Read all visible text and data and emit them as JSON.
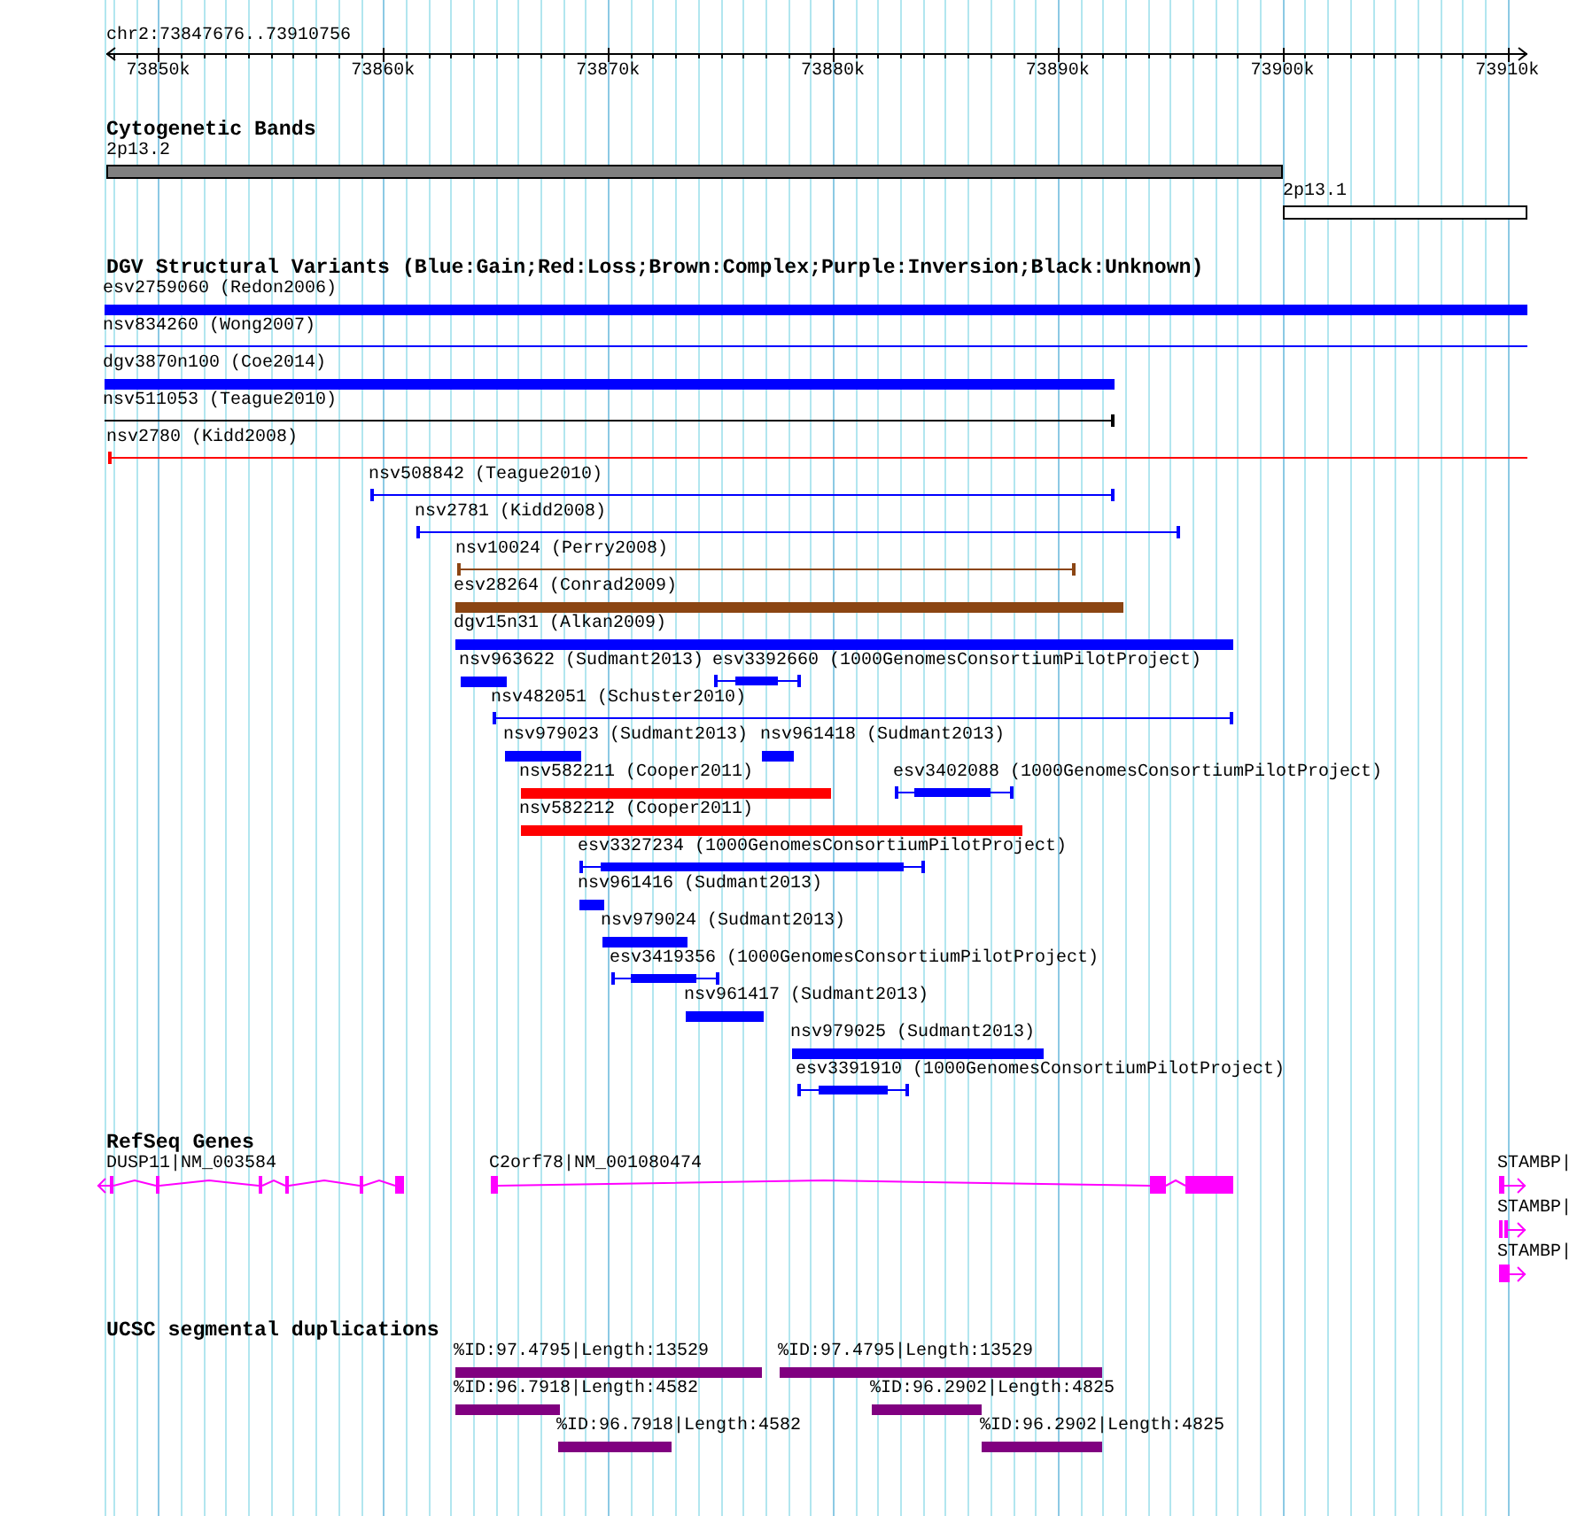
{
  "ruler": {
    "range": "chr2:73847676..73910756",
    "ticks": [
      "73850k",
      "73860k",
      "73870k",
      "73880k",
      "73890k",
      "73900k",
      "73910k"
    ]
  },
  "cytogenetic_bands": {
    "title": "Cytogenetic Bands",
    "bands": [
      {
        "name": "2p13.2",
        "color": "#808080"
      },
      {
        "name": "2p13.1",
        "color": "#ffffff"
      }
    ]
  },
  "dgv": {
    "title": "DGV Structural Variants (Blue:Gain;Red:Loss;Brown:Complex;Purple:Inversion;Black:Unknown)",
    "rows": [
      [
        {
          "label": "esv2759060 (Redon2006)",
          "kind": "bar",
          "color": "#0000ff"
        }
      ],
      [
        {
          "label": "nsv834260 (Wong2007)",
          "kind": "line",
          "color": "#0000ff"
        }
      ],
      [
        {
          "label": "dgv3870n100 (Coe2014)",
          "kind": "bar",
          "color": "#0000ff"
        }
      ],
      [
        {
          "label": "nsv511053 (Teague2010)",
          "kind": "line",
          "color": "#000000"
        }
      ],
      [
        {
          "label": "nsv2780 (Kidd2008)",
          "kind": "line",
          "color": "#ff0000"
        }
      ],
      [
        {
          "label": "nsv508842 (Teague2010)",
          "kind": "line",
          "color": "#0000ff"
        }
      ],
      [
        {
          "label": "nsv2781 (Kidd2008)",
          "kind": "line",
          "color": "#0000ff"
        }
      ],
      [
        {
          "label": "nsv10024 (Perry2008)",
          "kind": "line",
          "color": "#8b4513"
        }
      ],
      [
        {
          "label": "esv28264 (Conrad2009)",
          "kind": "bar",
          "color": "#8b4513"
        }
      ],
      [
        {
          "label": "dgv15n31 (Alkan2009)",
          "kind": "bar",
          "color": "#0000ff"
        }
      ],
      [
        {
          "label": "nsv963622 (Sudmant2013)",
          "kind": "bar",
          "color": "#0000ff"
        },
        {
          "label": "esv3392660 (1000GenomesConsortiumPilotProject)",
          "kind": "line_bar",
          "color": "#0000ff"
        }
      ],
      [
        {
          "label": "nsv482051 (Schuster2010)",
          "kind": "line",
          "color": "#0000ff"
        }
      ],
      [
        {
          "label": "nsv979023 (Sudmant2013)",
          "kind": "bar",
          "color": "#0000ff"
        },
        {
          "label": "nsv961418 (Sudmant2013)",
          "kind": "bar",
          "color": "#0000ff"
        }
      ],
      [
        {
          "label": "nsv582211 (Cooper2011)",
          "kind": "bar",
          "color": "#ff0000"
        },
        {
          "label": "esv3402088 (1000GenomesConsortiumPilotProject)",
          "kind": "line_bar",
          "color": "#0000ff"
        }
      ],
      [
        {
          "label": "nsv582212 (Cooper2011)",
          "kind": "bar",
          "color": "#ff0000"
        }
      ],
      [
        {
          "label": "esv3327234 (1000GenomesConsortiumPilotProject)",
          "kind": "line_bar",
          "color": "#0000ff"
        }
      ],
      [
        {
          "label": "nsv961416 (Sudmant2013)",
          "kind": "bar",
          "color": "#0000ff"
        }
      ],
      [
        {
          "label": "nsv979024 (Sudmant2013)",
          "kind": "bar",
          "color": "#0000ff"
        }
      ],
      [
        {
          "label": "esv3419356 (1000GenomesConsortiumPilotProject)",
          "kind": "line_bar",
          "color": "#0000ff"
        }
      ],
      [
        {
          "label": "nsv961417 (Sudmant2013)",
          "kind": "bar",
          "color": "#0000ff"
        }
      ],
      [
        {
          "label": "nsv979025 (Sudmant2013)",
          "kind": "bar",
          "color": "#0000ff"
        }
      ],
      [
        {
          "label": "esv3391910 (1000GenomesConsortiumPilotProject)",
          "kind": "line_bar",
          "color": "#0000ff"
        }
      ]
    ]
  },
  "refseq_genes": {
    "title": "RefSeq Genes",
    "rows": [
      [
        {
          "label": "DUSP11|NM_003584",
          "kind": "reverse"
        },
        {
          "label": "C2orf78|NM_001080474",
          "kind": "plain"
        },
        {
          "label": "STAMBP|",
          "kind": "forward"
        }
      ],
      [
        {
          "label": "STAMBP|",
          "kind": "forward"
        }
      ],
      [
        {
          "label": "STAMBP|",
          "kind": "forward"
        }
      ]
    ]
  },
  "segmental_duplications": {
    "title": "UCSC segmental duplications",
    "rows": [
      [
        {
          "label": "%ID:97.4795|Length:13529"
        },
        {
          "label": "%ID:97.4795|Length:13529"
        }
      ],
      [
        {
          "label": "%ID:96.7918|Length:4582"
        },
        {
          "label": "%ID:96.2902|Length:4825"
        }
      ],
      [
        {
          "label": "%ID:96.7918|Length:4582"
        },
        {
          "label": "%ID:96.2902|Length:4825"
        }
      ]
    ]
  }
}
